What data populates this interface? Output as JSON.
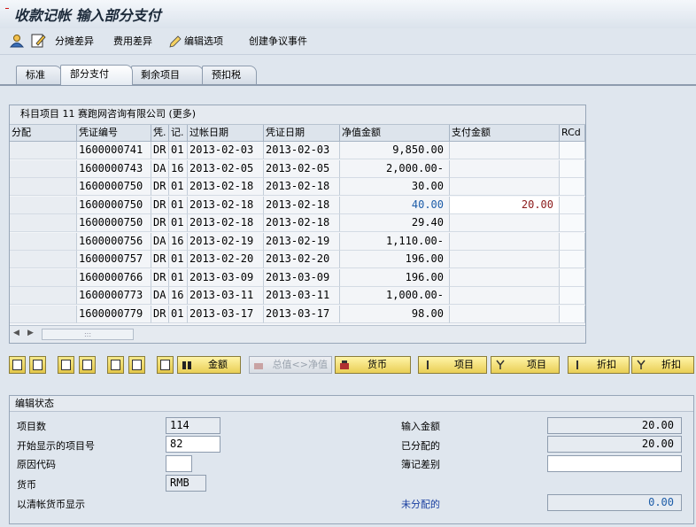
{
  "title": "收款记帐 输入部分支付",
  "toolbar": {
    "items": [
      "分摊差异",
      "费用差异",
      "编辑选项",
      "创建争议事件"
    ]
  },
  "tabs": [
    "标准",
    "部分支付",
    "剩余项目",
    "预扣税"
  ],
  "active_tab": "部分支付",
  "table": {
    "caption": "科目项目 11 赛跑网咨询有限公司 (更多)",
    "headers": [
      "分配",
      "凭证编号",
      "凭.",
      "记.",
      "过帐日期",
      "凭证日期",
      "净值金额",
      "支付金额",
      "RCd"
    ],
    "rows": [
      [
        "",
        "1600000741",
        "DR",
        "01",
        "2013-02-03",
        "2013-02-03",
        "9,850.00",
        "",
        ""
      ],
      [
        "",
        "1600000743",
        "DA",
        "16",
        "2013-02-05",
        "2013-02-05",
        "2,000.00-",
        "",
        ""
      ],
      [
        "",
        "1600000750",
        "DR",
        "01",
        "2013-02-18",
        "2013-02-18",
        "30.00",
        "",
        ""
      ],
      [
        "",
        "1600000750",
        "DR",
        "01",
        "2013-02-18",
        "2013-02-18",
        "40.00",
        "20.00",
        ""
      ],
      [
        "",
        "1600000750",
        "DR",
        "01",
        "2013-02-18",
        "2013-02-18",
        "29.40",
        "",
        ""
      ],
      [
        "",
        "1600000756",
        "DA",
        "16",
        "2013-02-19",
        "2013-02-19",
        "1,110.00-",
        "",
        ""
      ],
      [
        "",
        "1600000757",
        "DR",
        "01",
        "2013-02-20",
        "2013-02-20",
        "196.00",
        "",
        ""
      ],
      [
        "",
        "1600000766",
        "DR",
        "01",
        "2013-03-09",
        "2013-03-09",
        "196.00",
        "",
        ""
      ],
      [
        "",
        "1600000773",
        "DA",
        "16",
        "2013-03-11",
        "2013-03-11",
        "1,000.00-",
        "",
        ""
      ],
      [
        "",
        "1600000779",
        "DR",
        "01",
        "2013-03-17",
        "2013-03-17",
        "98.00",
        "",
        ""
      ]
    ],
    "highlight_row": 3
  },
  "buttons": {
    "amount": "金额",
    "gross_net": "总值<>净值",
    "currency": "货币",
    "items1": "项目",
    "items2": "项目",
    "discount1": "折扣",
    "discount2": "折扣"
  },
  "status": {
    "heading": "编辑状态",
    "item_count_label": "项目数",
    "item_count": "114",
    "first_item_label": "开始显示的项目号",
    "first_item": "82",
    "reason_code_label": "原因代码",
    "reason_code": "",
    "currency_label": "货币",
    "currency": "RMB",
    "clearing_currency_label": "以清帐货币显示",
    "entered_amount_label": "输入金额",
    "entered_amount": "20.00",
    "assigned_label": "已分配的",
    "assigned": "20.00",
    "difference_label": "簿记差别",
    "difference": "",
    "not_assigned_label": "未分配的",
    "not_assigned": "0.00"
  }
}
